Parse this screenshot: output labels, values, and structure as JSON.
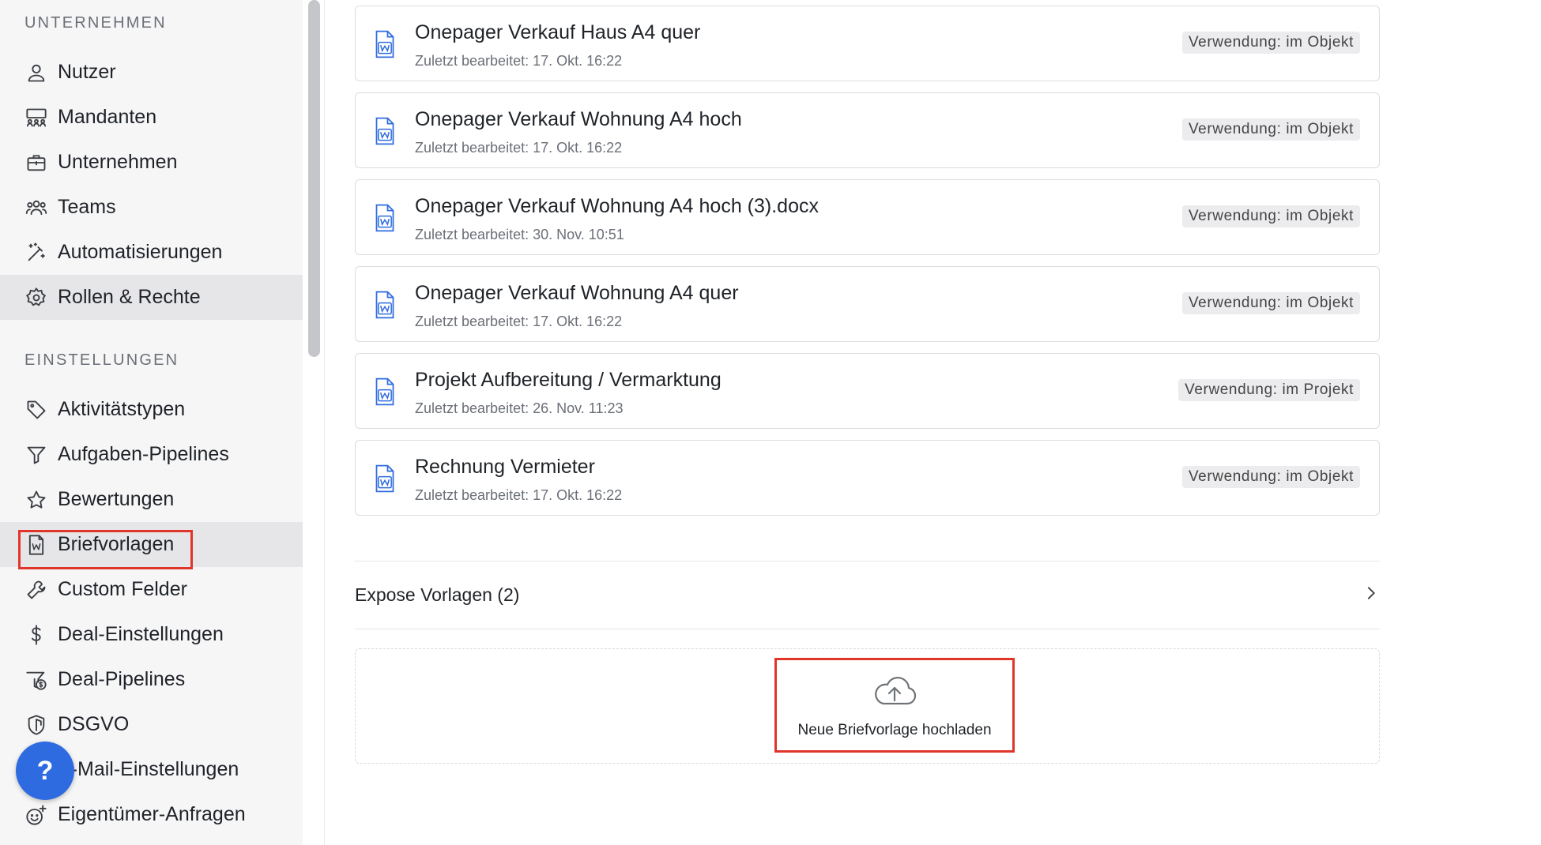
{
  "sidebar": {
    "section_company": "UNTERNEHMEN",
    "section_settings": "EINSTELLUNGEN",
    "company_items": [
      {
        "label": "Nutzer",
        "icon": "user-icon"
      },
      {
        "label": "Mandanten",
        "icon": "users-group-icon"
      },
      {
        "label": "Unternehmen",
        "icon": "briefcase-icon"
      },
      {
        "label": "Teams",
        "icon": "team-icon"
      },
      {
        "label": "Automatisierungen",
        "icon": "magic-wand-icon"
      },
      {
        "label": "Rollen & Rechte",
        "icon": "gear-icon"
      }
    ],
    "settings_items": [
      {
        "label": "Aktivitätstypen",
        "icon": "tag-icon"
      },
      {
        "label": "Aufgaben-Pipelines",
        "icon": "filter-icon"
      },
      {
        "label": "Bewertungen",
        "icon": "star-icon"
      },
      {
        "label": "Briefvorlagen",
        "icon": "word-document-icon"
      },
      {
        "label": "Custom Felder",
        "icon": "wrench-icon"
      },
      {
        "label": "Deal-Einstellungen",
        "icon": "dollar-icon"
      },
      {
        "label": "Deal-Pipelines",
        "icon": "dollar-filter-icon"
      },
      {
        "label": "DSGVO",
        "icon": "shield-icon"
      },
      {
        "label": "E-Mail-Einstellungen",
        "icon": "mail-icon"
      },
      {
        "label": "Eigentümer-Anfragen",
        "icon": "smiley-plus-icon"
      }
    ],
    "help_label": "?"
  },
  "templates": [
    {
      "title": "Onepager Verkauf Haus A4 quer",
      "subtitle": "Zuletzt bearbeitet: 17. Okt. 16:22",
      "badge": "Verwendung: im Objekt"
    },
    {
      "title": "Onepager Verkauf Wohnung A4 hoch",
      "subtitle": "Zuletzt bearbeitet: 17. Okt. 16:22",
      "badge": "Verwendung: im Objekt"
    },
    {
      "title": "Onepager Verkauf Wohnung A4 hoch (3).docx",
      "subtitle": "Zuletzt bearbeitet: 30. Nov. 10:51",
      "badge": "Verwendung: im Objekt"
    },
    {
      "title": "Onepager Verkauf Wohnung A4 quer",
      "subtitle": "Zuletzt bearbeitet: 17. Okt. 16:22",
      "badge": "Verwendung: im Objekt"
    },
    {
      "title": "Projekt Aufbereitung / Vermarktung",
      "subtitle": "Zuletzt bearbeitet: 26. Nov. 11:23",
      "badge": "Verwendung: im Projekt"
    },
    {
      "title": "Rechnung Vermieter",
      "subtitle": "Zuletzt bearbeitet: 17. Okt. 16:22",
      "badge": "Verwendung: im Objekt"
    }
  ],
  "expose": {
    "label": "Expose Vorlagen (2)"
  },
  "upload": {
    "label": "Neue Briefvorlage hochladen"
  },
  "colors": {
    "accent": "#2f6be0",
    "highlight": "#e0352b",
    "file_icon": "#2f6be0"
  }
}
